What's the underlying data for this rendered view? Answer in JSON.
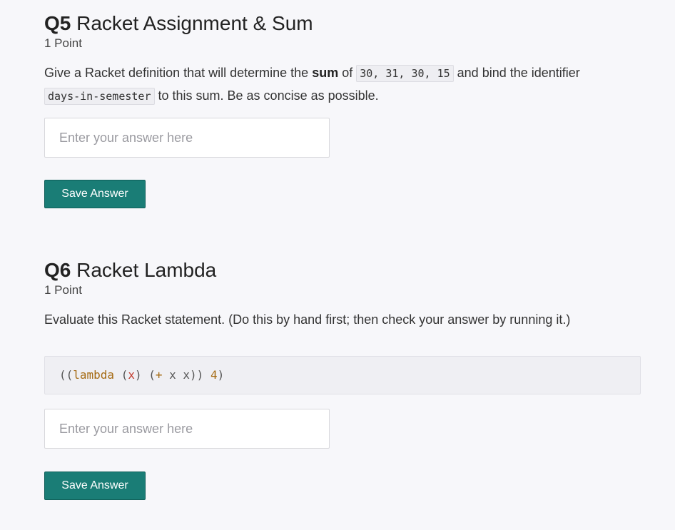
{
  "q5": {
    "number": "Q5",
    "title": "Racket Assignment & Sum",
    "points": "1 Point",
    "prompt": {
      "part1": "Give a Racket definition that will determine the ",
      "bold": "sum",
      "part2": " of ",
      "code1": "30, 31, 30, 15",
      "part3": " and bind the identifier ",
      "code2": "days-in-semester",
      "part4": " to this sum.  Be as concise as possible."
    },
    "answer_value": "",
    "answer_placeholder": "Enter your answer here",
    "save_label": "Save Answer"
  },
  "q6": {
    "number": "Q6",
    "title": "Racket Lambda",
    "points": "1 Point",
    "prompt": "Evaluate this Racket statement. (Do this by hand first; then check your answer by running it.)",
    "code": {
      "t1": "((",
      "t2": "lambda",
      "t3": " (",
      "t4": "x",
      "t5": ") (",
      "t6": "+",
      "t7": " x x)) ",
      "t8": "4",
      "t9": ")"
    },
    "answer_value": "",
    "answer_placeholder": "Enter your answer here",
    "save_label": "Save Answer"
  },
  "colors": {
    "button_bg": "#1a7d76",
    "page_bg": "#f7f7fa",
    "code_keyword": "#a56a12",
    "code_variable": "#c0392b"
  }
}
